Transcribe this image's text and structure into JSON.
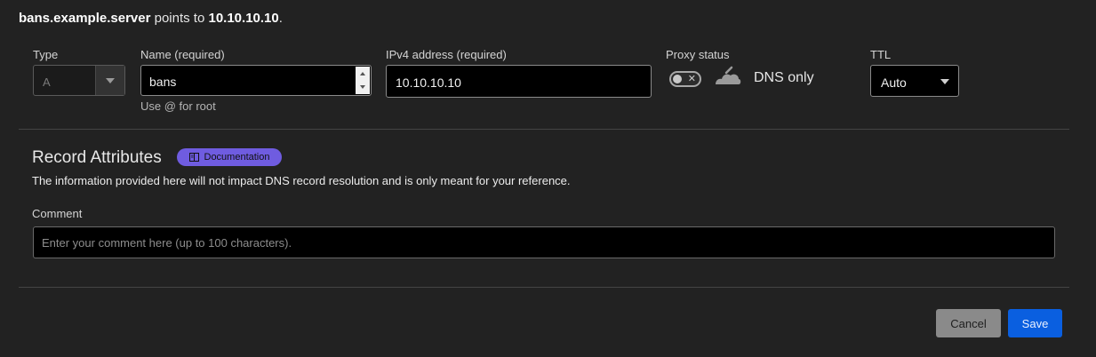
{
  "summary": {
    "host": "bans.example.server",
    "middle": " points to ",
    "target": "10.10.10.10",
    "end": "."
  },
  "fields": {
    "type": {
      "label": "Type",
      "value": "A"
    },
    "name": {
      "label": "Name (required)",
      "value": "bans",
      "hint": "Use @ for root"
    },
    "ipv4": {
      "label": "IPv4 address (required)",
      "value": "10.10.10.10"
    },
    "proxy": {
      "label": "Proxy status",
      "toggle_state": "off",
      "status_text": "DNS only"
    },
    "ttl": {
      "label": "TTL",
      "value": "Auto"
    }
  },
  "attributes": {
    "title": "Record Attributes",
    "doc_badge": "Documentation",
    "description": "The information provided here will not impact DNS record resolution and is only meant for your reference.",
    "comment_label": "Comment",
    "comment_placeholder": "Enter your comment here (up to 100 characters)."
  },
  "actions": {
    "cancel": "Cancel",
    "save": "Save"
  },
  "icons": {
    "toggle": "toggle-x-icon",
    "cloud": "cloud-icon",
    "doc": "book-icon",
    "caret": "caret-down-icon"
  },
  "colors": {
    "background": "#222222",
    "accent": "#0a5fe0",
    "badge": "#6f5ce0"
  }
}
